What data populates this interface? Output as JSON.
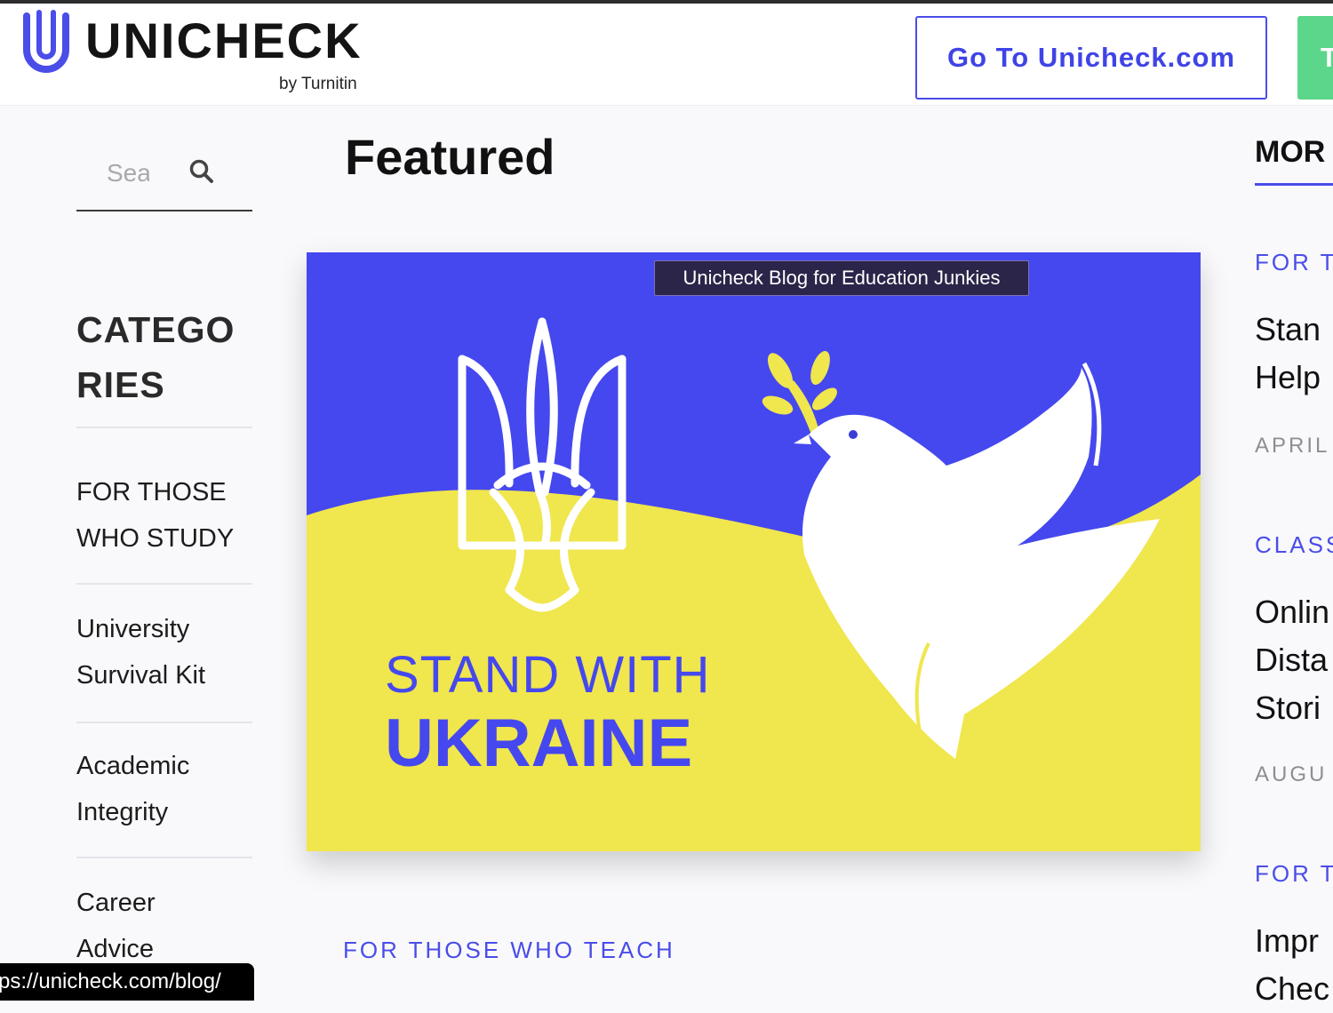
{
  "header": {
    "logo_text": "UNICHECK",
    "logo_sub": "by Turnitin",
    "goto_button": "Go To Unicheck.com",
    "try_button": "T",
    "colors": {
      "brand": "#4a4de8",
      "try": "#5cd68a"
    }
  },
  "sidebar": {
    "search_placeholder": "Sea",
    "categories_title": [
      "CATEGO",
      "RIES"
    ],
    "items": [
      {
        "lines": [
          "FOR THOSE",
          "WHO STUDY"
        ]
      },
      {
        "lines": [
          "University",
          "Survival Kit"
        ]
      },
      {
        "lines": [
          "Academic",
          "Integrity"
        ]
      },
      {
        "lines": [
          "Career",
          "Advice"
        ]
      }
    ]
  },
  "main": {
    "featured_title": "Featured",
    "banner": {
      "line1": "STAND WITH",
      "line2": "UKRAINE",
      "colors": {
        "blue": "#4548ee",
        "yellow": "#f0e64e"
      }
    },
    "tooltip": "Unicheck Blog for Education Junkies",
    "teach_label": "FOR THOSE WHO TEACH"
  },
  "right": {
    "more_title": "MOR",
    "posts": [
      {
        "category": "FOR T",
        "title": [
          "Stan",
          "Help"
        ],
        "date": "APRIL"
      },
      {
        "category": "CLASS",
        "title": [
          "Onlin",
          "Dista",
          "Stori"
        ],
        "date": "AUGU"
      },
      {
        "category": "FOR T",
        "title": [
          "Impr",
          "Chec"
        ],
        "date": ""
      }
    ]
  },
  "status_bar": {
    "url": "ps://unicheck.com/blog/"
  }
}
